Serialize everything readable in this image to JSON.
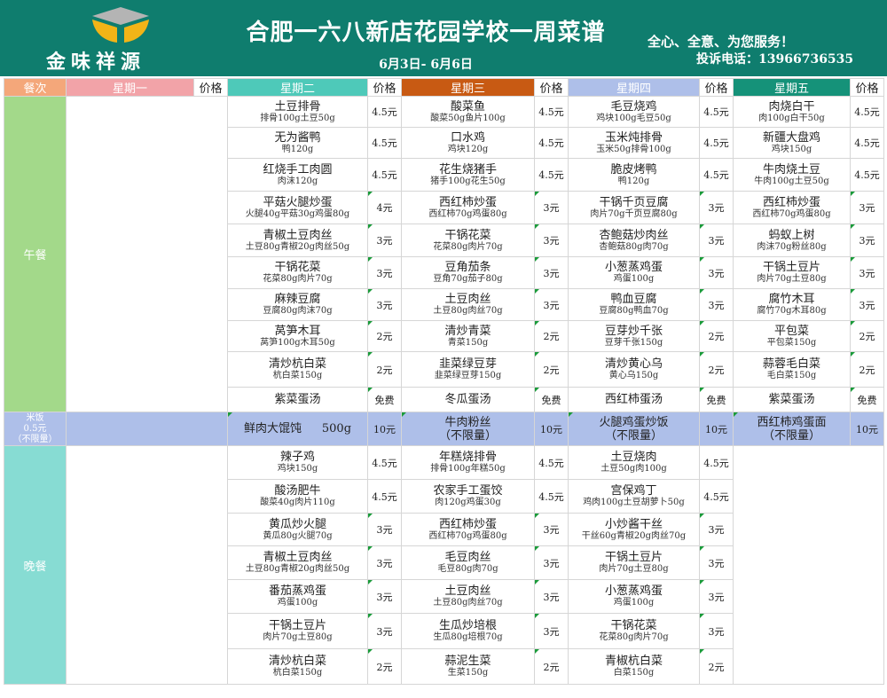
{
  "header": {
    "logo_text": "金味祥源",
    "title": "合肥一六八新店花园学校一周菜谱",
    "date_range": "6月3日- 6月6日",
    "slogan": "全心、全意、为您服务！",
    "hotline": "投诉电话：13966736535"
  },
  "colors": {
    "header_bg": "#0f7d6e",
    "col_meal": "#f4a77a",
    "col_mon": "#f2a3a8",
    "col_tue": "#4ec9b9",
    "col_wed": "#c85a13",
    "col_thu": "#aebfe9",
    "col_fri": "#159279",
    "lunch_side": "#a3d98a",
    "dinner_side": "#87dcd3",
    "staple_row": "#aebfe9"
  },
  "columns": {
    "meal": "餐次",
    "mon": "星期一",
    "tue": "星期二",
    "wed": "星期三",
    "thu": "星期四",
    "fri": "星期五",
    "price": "价格"
  },
  "lunch": {
    "label": "午餐",
    "rows": [
      [
        {
          "d": "土豆排骨",
          "i": "排骨100g土豆50g",
          "p": "4.5元"
        },
        {
          "d": "酸菜鱼",
          "i": "酸菜50g鱼片100g",
          "p": "4.5元"
        },
        {
          "d": "毛豆烧鸡",
          "i": "鸡块100g毛豆50g",
          "p": "4.5元"
        },
        {
          "d": "肉烧白干",
          "i": "肉100g白干50g",
          "p": "4.5元"
        }
      ],
      [
        {
          "d": "无为酱鸭",
          "i": "鸭120g",
          "p": "4.5元"
        },
        {
          "d": "口水鸡",
          "i": "鸡块120g",
          "p": "4.5元"
        },
        {
          "d": "玉米炖排骨",
          "i": "玉米50g排骨100g",
          "p": "4.5元"
        },
        {
          "d": "新疆大盘鸡",
          "i": "鸡块150g",
          "p": "4.5元"
        }
      ],
      [
        {
          "d": "红烧手工肉圆",
          "i": "肉沫120g",
          "p": "4.5元"
        },
        {
          "d": "花生烧猪手",
          "i": "猪手100g花生50g",
          "p": "4.5元"
        },
        {
          "d": "脆皮烤鸭",
          "i": "鸭120g",
          "p": "4.5元"
        },
        {
          "d": "牛肉烧土豆",
          "i": "牛肉100g土豆50g",
          "p": "4.5元"
        }
      ],
      [
        {
          "d": "平菇火腿炒蛋",
          "i": "火腿40g平菇30g鸡蛋80g",
          "p": "4元"
        },
        {
          "d": "西红柿炒蛋",
          "i": "西红柿70g鸡蛋80g",
          "p": "3元"
        },
        {
          "d": "干锅千页豆腐",
          "i": "肉片70g千页豆腐80g",
          "p": "3元"
        },
        {
          "d": "西红柿炒蛋",
          "i": "西红柿70g鸡蛋80g",
          "p": "3元"
        }
      ],
      [
        {
          "d": "青椒土豆肉丝",
          "i": "土豆80g青椒20g肉丝50g",
          "p": "3元"
        },
        {
          "d": "干锅花菜",
          "i": "花菜80g肉片70g",
          "p": "3元"
        },
        {
          "d": "杏鲍菇炒肉丝",
          "i": "杏鲍菇80g肉70g",
          "p": "3元"
        },
        {
          "d": "蚂蚁上树",
          "i": "肉沫70g粉丝80g",
          "p": "3元"
        }
      ],
      [
        {
          "d": "干锅花菜",
          "i": "花菜80g肉片70g",
          "p": "3元"
        },
        {
          "d": "豆角茄条",
          "i": "豆角70g茄子80g",
          "p": "3元"
        },
        {
          "d": "小葱蒸鸡蛋",
          "i": "鸡蛋100g",
          "p": "3元"
        },
        {
          "d": "干锅土豆片",
          "i": "肉片70g土豆80g",
          "p": "3元"
        }
      ],
      [
        {
          "d": "麻辣豆腐",
          "i": "豆腐80g肉沫70g",
          "p": "3元"
        },
        {
          "d": "土豆肉丝",
          "i": "土豆80g肉丝70g",
          "p": "3元"
        },
        {
          "d": "鸭血豆腐",
          "i": "豆腐80g鸭血70g",
          "p": "3元"
        },
        {
          "d": "腐竹木耳",
          "i": "腐竹70g木耳80g",
          "p": "3元"
        }
      ],
      [
        {
          "d": "莴笋木耳",
          "i": "莴笋100g木耳50g",
          "p": "2元"
        },
        {
          "d": "清炒青菜",
          "i": "青菜150g",
          "p": "2元"
        },
        {
          "d": "豆芽炒千张",
          "i": "豆芽千张150g",
          "p": "2元"
        },
        {
          "d": "平包菜",
          "i": "平包菜150g",
          "p": "2元"
        }
      ],
      [
        {
          "d": "清炒杭白菜",
          "i": "杭白菜150g",
          "p": "2元"
        },
        {
          "d": "韭菜绿豆芽",
          "i": "韭菜绿豆芽150g",
          "p": "2元"
        },
        {
          "d": "清炒黄心乌",
          "i": "黄心乌150g",
          "p": "2元"
        },
        {
          "d": "蒜蓉毛白菜",
          "i": "毛白菜150g",
          "p": "2元"
        }
      ],
      [
        {
          "d": "紫菜蛋汤",
          "i": "",
          "p": "免费"
        },
        {
          "d": "冬瓜蛋汤",
          "i": "",
          "p": "免费"
        },
        {
          "d": "西红柿蛋汤",
          "i": "",
          "p": "免费"
        },
        {
          "d": "紫菜蛋汤",
          "i": "",
          "p": "免费"
        }
      ]
    ]
  },
  "staple": {
    "rice_line1": "米饭",
    "rice_line2": "0.5元",
    "rice_line3": "（不限量）",
    "items": [
      {
        "d1": "鲜肉大馄饨",
        "d2": "500g",
        "p": "10元"
      },
      {
        "d1": "牛肉粉丝",
        "d2": "（不限量）",
        "p": "10元"
      },
      {
        "d1": "火腿鸡蛋炒饭",
        "d2": "（不限量）",
        "p": "10元"
      },
      {
        "d1": "西红柿鸡蛋面",
        "d2": "（不限量）",
        "p": "10元"
      }
    ]
  },
  "dinner": {
    "label": "晚餐",
    "rows": [
      [
        {
          "d": "辣子鸡",
          "i": "鸡块150g",
          "p": "4.5元"
        },
        {
          "d": "年糕烧排骨",
          "i": "排骨100g年糕50g",
          "p": "4.5元"
        },
        {
          "d": "土豆烧肉",
          "i": "土豆50g肉100g",
          "p": "4.5元"
        }
      ],
      [
        {
          "d": "酸汤肥牛",
          "i": "酸菜40g肉片110g",
          "p": "4.5元"
        },
        {
          "d": "农家手工蛋饺",
          "i": "肉120g鸡蛋30g",
          "p": "4.5元"
        },
        {
          "d": "宫保鸡丁",
          "i": "鸡肉100g土豆胡萝卜50g",
          "p": "4.5元"
        }
      ],
      [
        {
          "d": "黄瓜炒火腿",
          "i": "黄瓜80g火腿70g",
          "p": "3元"
        },
        {
          "d": "西红柿炒蛋",
          "i": "西红柿70g鸡蛋80g",
          "p": "3元"
        },
        {
          "d": "小炒酱干丝",
          "i": "干丝60g青椒20g肉丝70g",
          "p": "3元"
        }
      ],
      [
        {
          "d": "青椒土豆肉丝",
          "i": "土豆80g青椒20g肉丝50g",
          "p": "3元"
        },
        {
          "d": "毛豆肉丝",
          "i": "毛豆80g肉70g",
          "p": "3元"
        },
        {
          "d": "干锅土豆片",
          "i": "肉片70g土豆80g",
          "p": "3元"
        }
      ],
      [
        {
          "d": "番茄蒸鸡蛋",
          "i": "鸡蛋100g",
          "p": "3元"
        },
        {
          "d": "土豆肉丝",
          "i": "土豆80g肉丝70g",
          "p": "3元"
        },
        {
          "d": "小葱蒸鸡蛋",
          "i": "鸡蛋100g",
          "p": "3元"
        }
      ],
      [
        {
          "d": "干锅土豆片",
          "i": "肉片70g土豆80g",
          "p": "3元"
        },
        {
          "d": "生瓜炒培根",
          "i": "生瓜80g培根70g",
          "p": "3元"
        },
        {
          "d": "干锅花菜",
          "i": "花菜80g肉片70g",
          "p": "3元"
        }
      ],
      [
        {
          "d": "清炒杭白菜",
          "i": "杭白菜150g",
          "p": "2元"
        },
        {
          "d": "蒜泥生菜",
          "i": "生菜150g",
          "p": "2元"
        },
        {
          "d": "青椒杭白菜",
          "i": "白菜150g",
          "p": "2元"
        }
      ]
    ]
  }
}
